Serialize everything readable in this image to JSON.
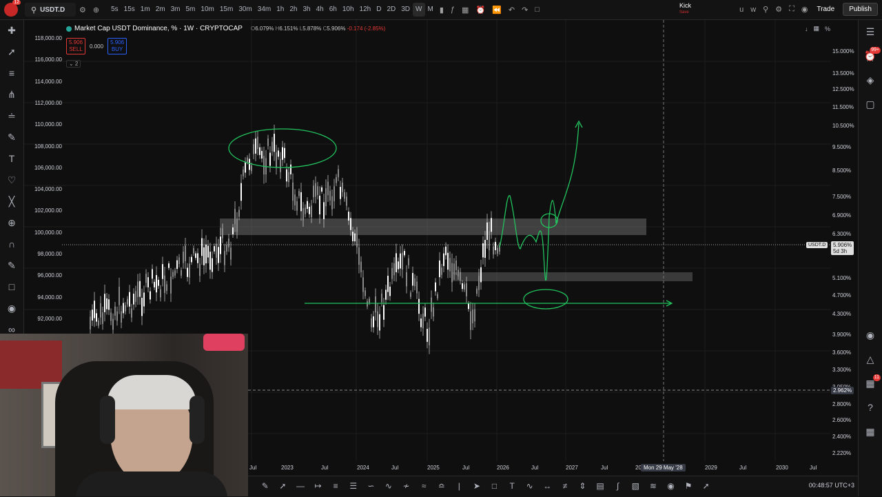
{
  "topbar": {
    "notifications": "12",
    "symbol": "USDT.D",
    "intervals": [
      "5s",
      "15s",
      "1m",
      "2m",
      "3m",
      "5m",
      "10m",
      "15m",
      "30m",
      "34m",
      "1h",
      "2h",
      "3h",
      "4h",
      "6h",
      "10h",
      "12h",
      "D",
      "2D",
      "3D",
      "W",
      "M"
    ],
    "active_interval": "W",
    "account_name": "Kick",
    "account_sub": "Save",
    "user_initial_1": "u",
    "user_initial_2": "w",
    "trade_label": "Trade",
    "publish_label": "Publish"
  },
  "legend": {
    "title": "Market Cap USDT Dominance, % · 1W · CRYPTOCAP",
    "open_label": "O",
    "open": "6.079%",
    "high_label": "H",
    "high": "6.151%",
    "low_label": "L",
    "low": "5.878%",
    "close_label": "C",
    "close": "5.906%",
    "change": "-0.174 (-2.85%)",
    "sell_price": "5.906",
    "sell_label": "SELL",
    "spread": "0.000",
    "buy_price": "5.906",
    "buy_label": "BUY",
    "collapse": "⌄ 2"
  },
  "scale_tools": {
    "percent": "%"
  },
  "left_scale": [
    "118,000.00",
    "116,000.00",
    "114,000.00",
    "112,000.00",
    "110,000.00",
    "108,000.00",
    "106,000.00",
    "104,000.00",
    "102,000.00",
    "100,000.00",
    "98,000.00",
    "96,000.00",
    "94,000.00",
    "92,000.00"
  ],
  "right_scale": [
    "15.000%",
    "13.500%",
    "12.500%",
    "11.500%",
    "10.500%",
    "9.500%",
    "8.500%",
    "7.500%",
    "6.900%",
    "6.300%",
    "5.100%",
    "4.700%",
    "4.300%",
    "3.900%",
    "3.600%",
    "3.300%",
    "3.050%",
    "2.800%",
    "2.600%",
    "2.400%",
    "2.220%"
  ],
  "price_label": {
    "symbol": "USDT.D",
    "value": "5.906%",
    "countdown": "5d 3h"
  },
  "cross_price": "2.962%",
  "time_axis": [
    "Jul",
    "2023",
    "Jul",
    "2024",
    "Jul",
    "2025",
    "Jul",
    "2026",
    "Jul",
    "2027",
    "Jul",
    "2028",
    "2029",
    "Jul",
    "2030",
    "Jul"
  ],
  "time_cross": "Mon 29 May '28",
  "clock": "00:48:57 UTC+3",
  "right_badges": {
    "alerts": "99+",
    "notifications": "11"
  },
  "colors": {
    "drawing": "#22c55e",
    "zone": "#9e9e9e",
    "accent": "#2962ff",
    "down": "#e53935"
  }
}
